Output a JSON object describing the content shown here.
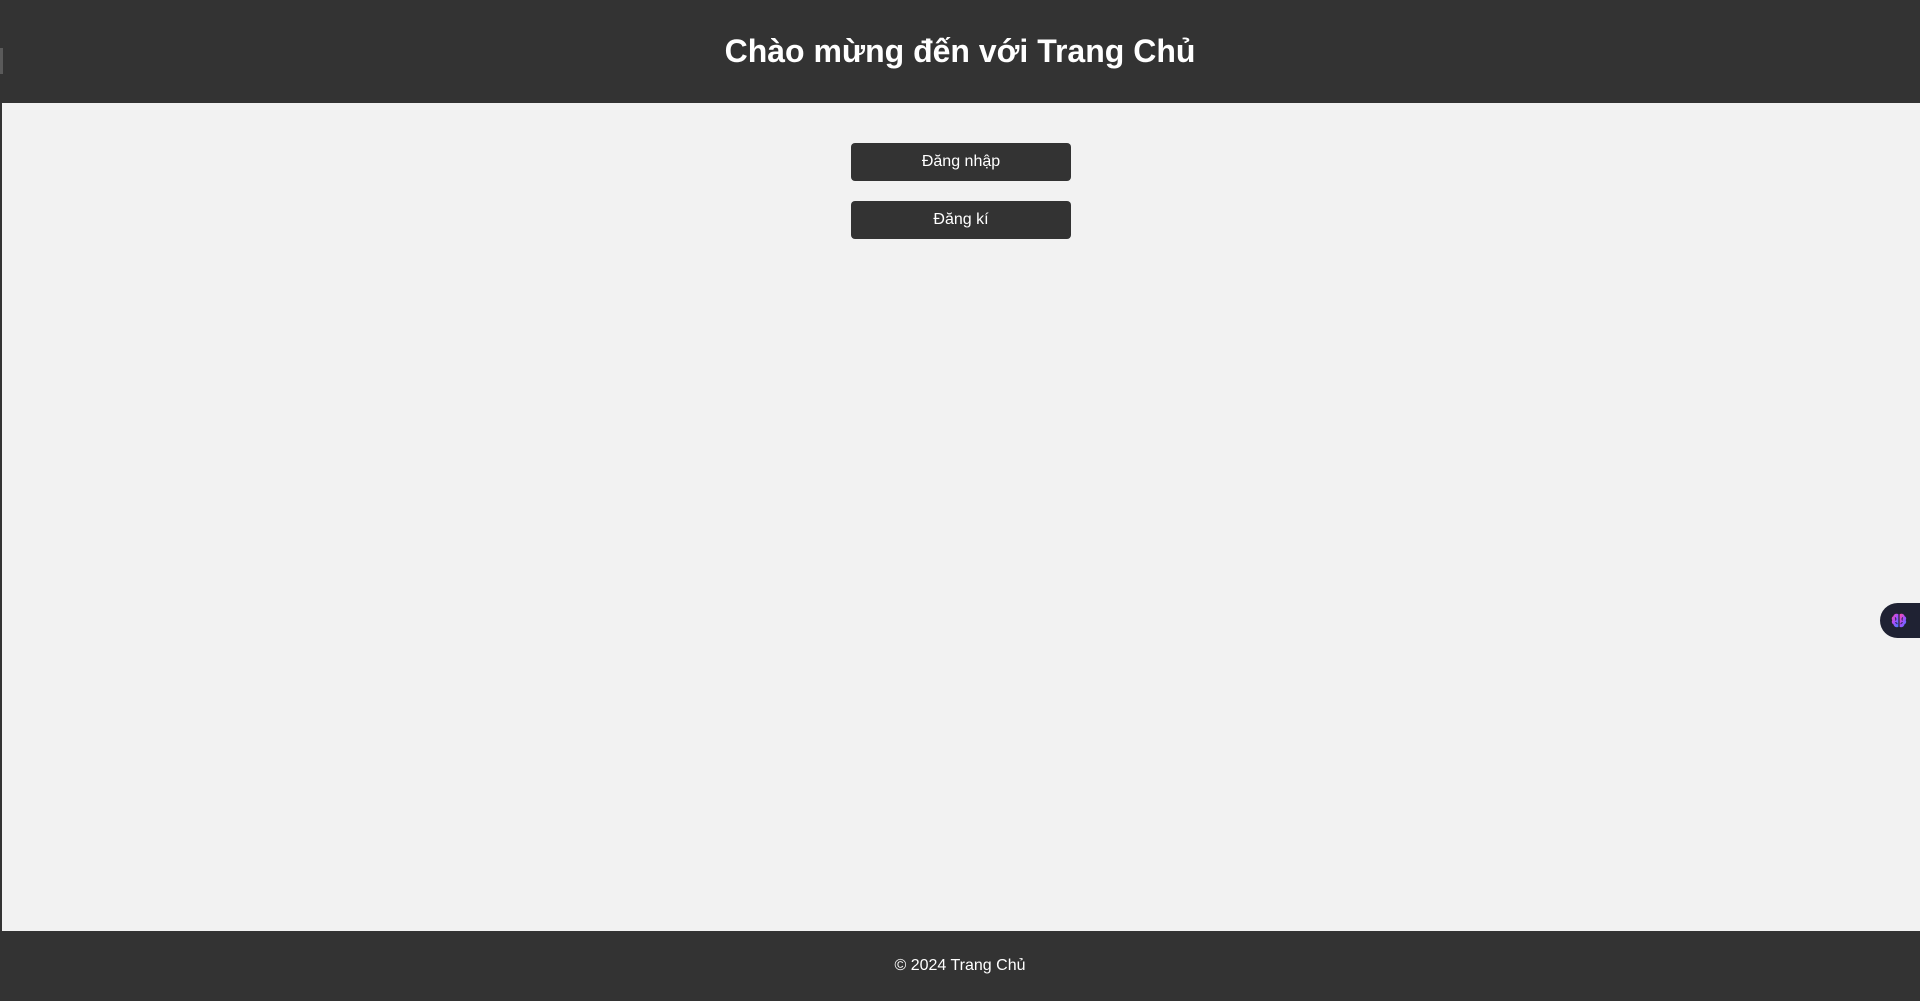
{
  "header": {
    "title": "Chào mừng đến với Trang Chủ"
  },
  "actions": {
    "login_label": "Đăng nhập",
    "register_label": "Đăng kí"
  },
  "footer": {
    "text": "© 2024 Trang Chủ"
  },
  "floating_widget": {
    "icon": "brain-icon"
  },
  "colors": {
    "bar": "#333333",
    "background": "#f2f2f2",
    "text_light": "#ffffff",
    "widget_bg": "#1f2233"
  }
}
